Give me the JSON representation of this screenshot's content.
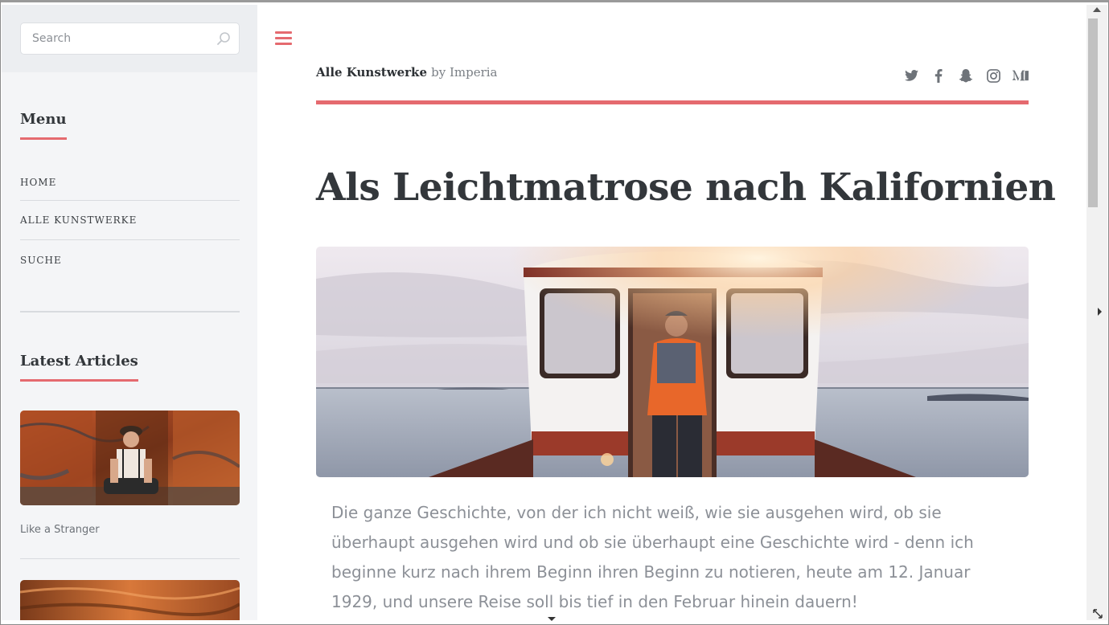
{
  "search": {
    "placeholder": "Search"
  },
  "sidebar": {
    "menu_heading": "Menu",
    "menu_items": [
      {
        "label": "HOME"
      },
      {
        "label": "ALLE KUNSTWERKE"
      },
      {
        "label": "SUCHE"
      }
    ],
    "latest_heading": "Latest Articles",
    "articles": [
      {
        "caption": "Like a Stranger"
      }
    ]
  },
  "header": {
    "site_title": "Alle Kunstwerke",
    "site_by": "by Imperia",
    "social_icons": [
      "twitter-icon",
      "facebook-icon",
      "snapchat-icon",
      "instagram-icon",
      "medium-icon"
    ]
  },
  "post": {
    "title": "Als Leichtmatrose nach Kalifornien",
    "body": "Die ganze Geschichte, von der ich nicht weiß, wie sie ausgehen wird, ob sie überhaupt ausgehen wird und ob sie überhaupt eine Geschichte wird - denn ich beginne kurz nach ihrem Beginn ihren Beginn zu notieren, heute am 12. Januar 1929, und unsere Reise soll bis tief in den Februar hinein dauern!"
  },
  "colors": {
    "accent": "#e56a6f",
    "sidebar_bg": "#f4f5f7",
    "text_dark": "#33373b",
    "text_muted": "#8c9097"
  }
}
